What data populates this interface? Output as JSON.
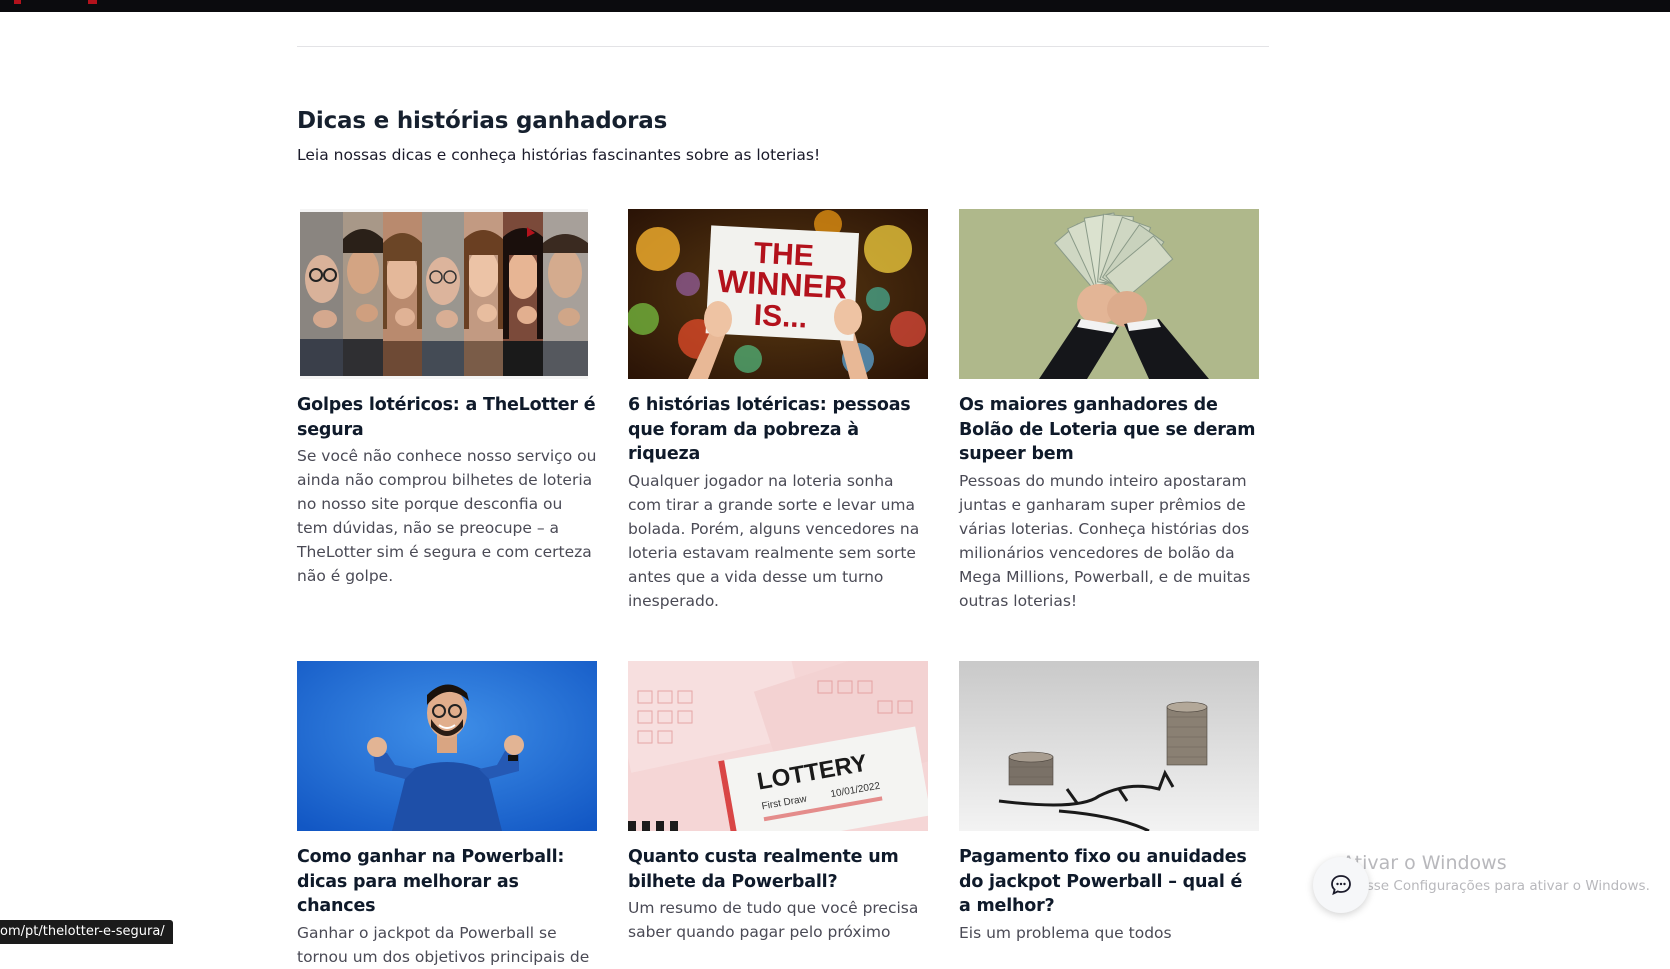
{
  "section": {
    "title": "Dicas e histórias ganhadoras",
    "subtitle": "Leia nossas dicas e conheça histórias fascinantes sobre as loterias!"
  },
  "cards": [
    {
      "title": "Golpes lotéricos: a TheLotter é segura",
      "desc": "Se você não conhece nosso serviço ou ainda não comprou bilhetes de loteria no nosso site porque desconfia ou tem dúvidas, não se preocupe – a TheLotter sim é segura e com certeza não é golpe.",
      "image": "thinking-faces-collage"
    },
    {
      "title": "6 histórias lotéricas: pessoas que foram da pobreza à riqueza",
      "desc": "Qualquer jogador na loteria sonha com tirar a grande sorte e levar uma bolada. Porém, alguns vencedores na loteria estavam realmente sem sorte antes que a vida desse um turno inesperado.",
      "image": "the-winner-is-sign",
      "image_text": [
        "THE",
        "WINNER",
        "IS..."
      ]
    },
    {
      "title": "Os maiores ganhadores de Bolão de Loteria que se deram supeer bem",
      "desc": "Pessoas do mundo inteiro apostaram juntas e ganharam super prêmios de várias loterias. Conheça histórias dos milionários vencedores de bolão da Mega Millions, Powerball, e de muitas outras loterias!",
      "image": "hands-holding-cash"
    },
    {
      "title": "Como ganhar na Powerball: dicas para melhorar as chances",
      "desc": "Ganhar o jackpot da Powerball se tornou um dos objetivos principais de",
      "image": "happy-man-blue-background"
    },
    {
      "title": "Quanto custa realmente um bilhete da Powerball?",
      "desc": "Um resumo de tudo que você precisa saber quando pagar pelo próximo",
      "image": "lottery-tickets",
      "image_text": [
        "LOTTERY",
        "First Draw",
        "10/01/2022"
      ]
    },
    {
      "title": "Pagamento fixo ou anuidades do jackpot Powerball – qual é a melhor?",
      "desc": "Eis um problema que todos",
      "image": "coin-stacks"
    }
  ],
  "status_bar": {
    "url": "om/pt/thelotter-e-segura/"
  },
  "windows_watermark": {
    "title": "Ativar o Windows",
    "subtitle": "Acesse Configurações para ativar o Windows."
  },
  "colors": {
    "heading": "#16202e",
    "body_text": "#4a4a55",
    "topbar": "#0b0b0e",
    "accent_red": "#b3121c"
  }
}
